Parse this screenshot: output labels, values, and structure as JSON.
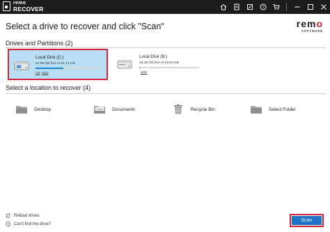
{
  "app": {
    "logo_top": "remo",
    "logo_bottom": "RECOVER"
  },
  "titlebar_icons": [
    "home-icon",
    "report-icon",
    "feedback-icon",
    "help-icon",
    "cart-icon",
    "minimize-icon",
    "maximize-icon",
    "close-icon"
  ],
  "header": {
    "title": "Select a drive to recover and click \"Scan\"",
    "brand_word_prefix": "rem",
    "brand_word_accent": "o",
    "brand_sub": "SOFTWARE",
    "brand_accent_color": "#d2232a"
  },
  "drives_section": {
    "label": "Drives and Partitions",
    "count": "(2)",
    "drives": [
      {
        "name": "Local Disk (C:)",
        "free": "51.68 GB free of 91.71 GB",
        "tag_os": "OS",
        "tag_type": "SSD",
        "used_fraction": 0.44,
        "selected": true
      },
      {
        "name": "Local Disk (B:)",
        "free": "19.48 GB free of 19.53 GB",
        "tag_type": "SSD",
        "used_fraction": 0.003,
        "selected": false
      }
    ]
  },
  "locations_section": {
    "label": "Select a location to recover",
    "count": "(4)",
    "items": [
      {
        "label": "Desktop",
        "icon": "folder-icon"
      },
      {
        "label": "Documents",
        "icon": "documents-folder-icon"
      },
      {
        "label": "Recycle Bin",
        "icon": "recycle-bin-icon"
      },
      {
        "label": "Select Folder",
        "icon": "folder-icon"
      }
    ]
  },
  "footer": {
    "reload_label": "Reload drives",
    "cant_find_label": "Can't find the drive?",
    "scan_label": "Scan"
  },
  "colors": {
    "accent": "#1e73c6",
    "selection": "#b8dff3",
    "highlight": "#d3223a",
    "titlebar": "#1c1c1c"
  }
}
